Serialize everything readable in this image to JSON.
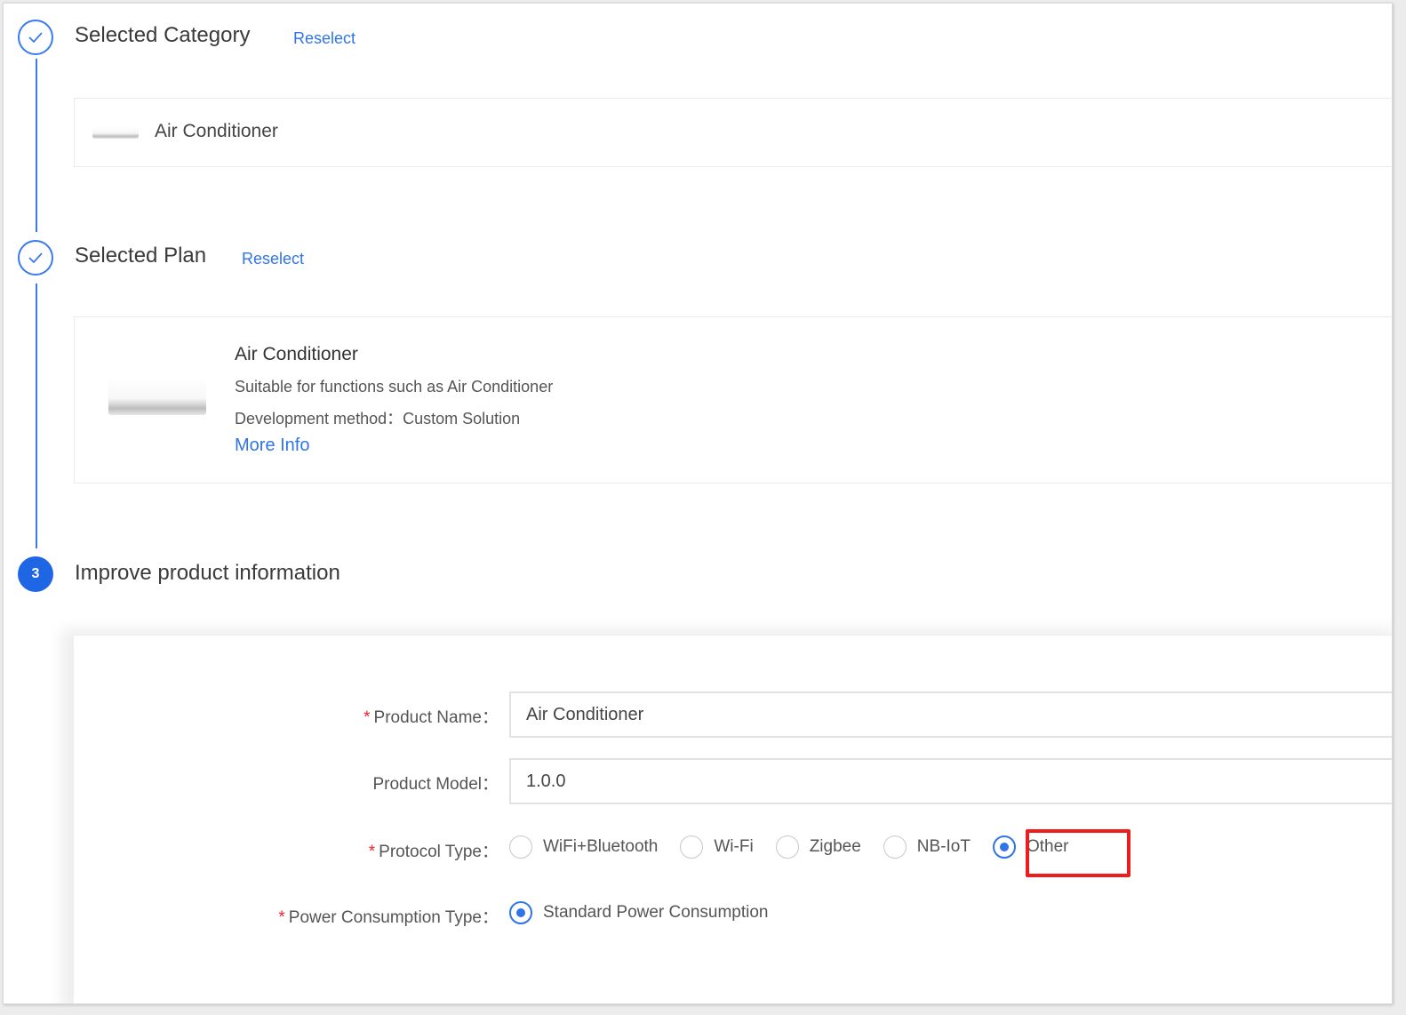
{
  "steps": [
    {
      "status": "done",
      "title": "Selected Category",
      "action_label": "Reselect",
      "icon": "check-icon",
      "category": {
        "name": "Air Conditioner",
        "image": "air-conditioner-image"
      }
    },
    {
      "status": "done",
      "title": "Selected Plan",
      "action_label": "Reselect",
      "icon": "check-icon",
      "plan": {
        "name": "Air Conditioner",
        "description": "Suitable for functions such as Air Conditioner",
        "development_method": "Development method：Custom Solution",
        "more_info_label": "More Info",
        "image": "air-conditioner-image"
      }
    },
    {
      "status": "active",
      "number": "3",
      "title": "Improve product information"
    }
  ],
  "form": {
    "product_name": {
      "label": "Product Name",
      "required": true,
      "value": "Air Conditioner"
    },
    "product_model": {
      "label": "Product Model",
      "required": false,
      "value": "1.0.0"
    },
    "protocol_type": {
      "label": "Protocol Type",
      "required": true,
      "options": [
        "WiFi+Bluetooth",
        "Wi-Fi",
        "Zigbee",
        "NB-IoT",
        "Other"
      ],
      "selected": "Other"
    },
    "power_consumption_type": {
      "label": "Power Consumption Type",
      "required": true,
      "options": [
        "Standard Power Consumption"
      ],
      "selected": "Standard Power Consumption"
    },
    "colon": "：",
    "required_mark": "*"
  },
  "annotation": {
    "highlight_target": "Other",
    "color": "#ee1c1c"
  },
  "colors": {
    "accent": "#2f74e8",
    "step_active": "#1f66e5",
    "required": "#f5222d"
  }
}
